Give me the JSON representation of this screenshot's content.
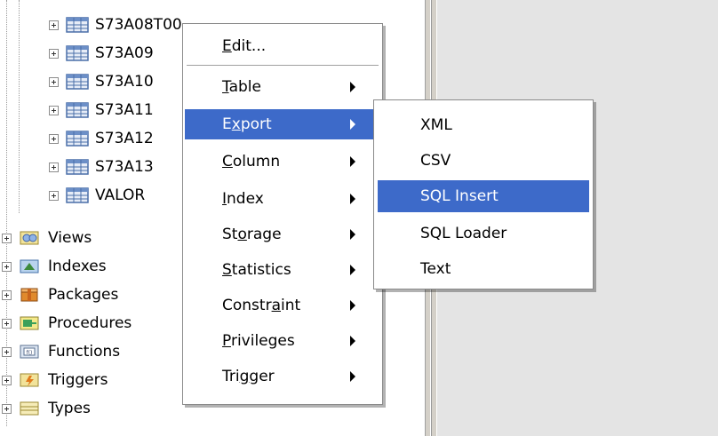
{
  "tree": {
    "tables": [
      "S73A08T00",
      "S73A09",
      "S73A10",
      "S73A11",
      "S73A12",
      "S73A13",
      "VALOR"
    ],
    "folders": [
      "Views",
      "Indexes",
      "Packages",
      "Procedures",
      "Functions",
      "Triggers",
      "Types"
    ]
  },
  "context_menu": {
    "edit": "Edit...",
    "items": [
      {
        "label": "Table",
        "mnemonic": "T"
      },
      {
        "label": "Export",
        "mnemonic": "x",
        "selected": true
      },
      {
        "label": "Column",
        "mnemonic": "C"
      },
      {
        "label": "Index",
        "mnemonic": "I"
      },
      {
        "label": "Storage",
        "mnemonic": "o"
      },
      {
        "label": "Statistics",
        "mnemonic": "S"
      },
      {
        "label": "Constraint",
        "mnemonic": "a"
      },
      {
        "label": "Privileges",
        "mnemonic": "P"
      },
      {
        "label": "Trigger",
        "mnemonic": "g"
      }
    ]
  },
  "export_submenu": {
    "items": [
      {
        "label": "XML"
      },
      {
        "label": "CSV"
      },
      {
        "label": "SQL Insert",
        "selected": true
      },
      {
        "label": "SQL Loader"
      },
      {
        "label": "Text"
      }
    ]
  },
  "colors": {
    "selection": "#3d6ac9",
    "splitter": "#d4d0c8",
    "right_panel": "#e4e4e4"
  }
}
